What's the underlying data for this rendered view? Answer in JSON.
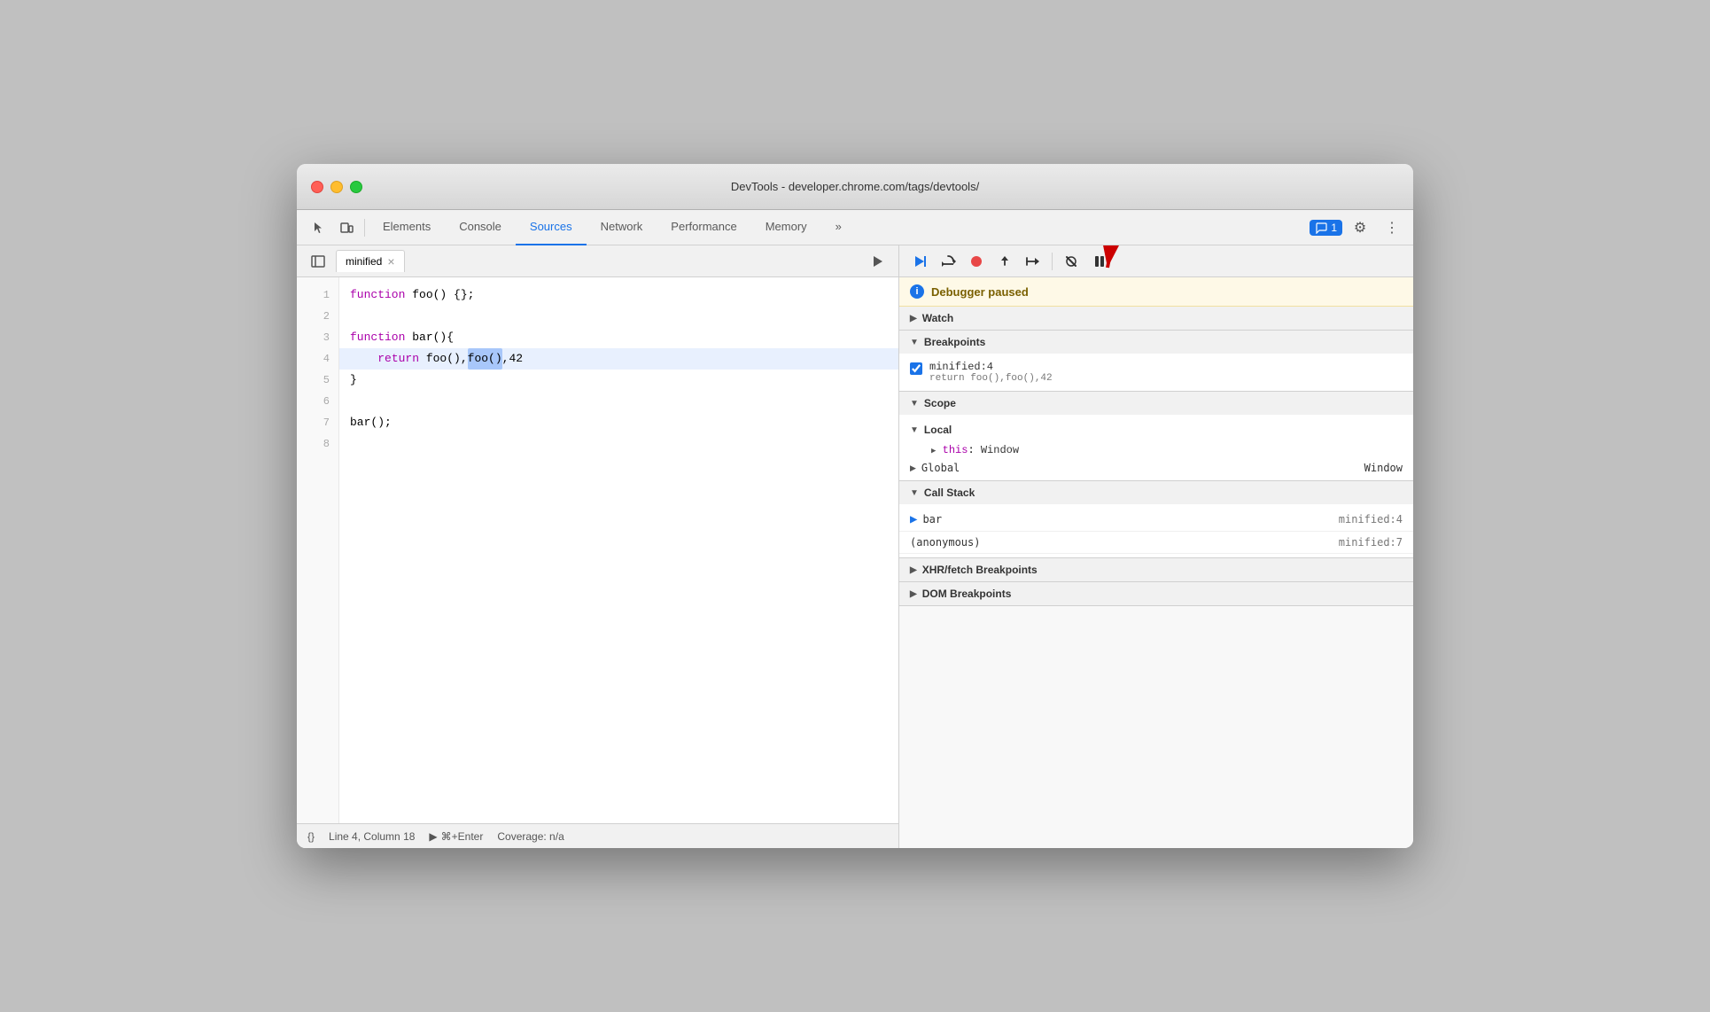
{
  "window": {
    "title": "DevTools - developer.chrome.com/tags/devtools/"
  },
  "tabs": [
    {
      "id": "elements",
      "label": "Elements",
      "active": false
    },
    {
      "id": "console",
      "label": "Console",
      "active": false
    },
    {
      "id": "sources",
      "label": "Sources",
      "active": true
    },
    {
      "id": "network",
      "label": "Network",
      "active": false
    },
    {
      "id": "performance",
      "label": "Performance",
      "active": false
    },
    {
      "id": "memory",
      "label": "Memory",
      "active": false
    }
  ],
  "toolbar": {
    "more_label": "»",
    "notification_count": "1",
    "settings_icon": "⚙",
    "more_options_icon": "⋮"
  },
  "source_file": {
    "name": "minified",
    "lines": [
      {
        "num": "1",
        "content": "function foo() {};",
        "highlighted": false
      },
      {
        "num": "2",
        "content": "",
        "highlighted": false
      },
      {
        "num": "3",
        "content": "function bar(){",
        "highlighted": false
      },
      {
        "num": "4",
        "content": "    return foo(),foo(),42",
        "highlighted": true
      },
      {
        "num": "5",
        "content": "}",
        "highlighted": false
      },
      {
        "num": "6",
        "content": "",
        "highlighted": false
      },
      {
        "num": "7",
        "content": "bar();",
        "highlighted": false
      },
      {
        "num": "8",
        "content": "",
        "highlighted": false
      }
    ]
  },
  "status_bar": {
    "format_icon": "{}",
    "position": "Line 4, Column 18",
    "run_icon": "▶",
    "shortcut": "⌘+Enter",
    "coverage": "Coverage: n/a"
  },
  "debugger": {
    "paused_message": "Debugger paused",
    "watch_label": "Watch",
    "breakpoints_label": "Breakpoints",
    "scope_label": "Scope",
    "local_label": "Local",
    "this_label": "this",
    "this_value": "Window",
    "global_label": "Global",
    "global_value": "Window",
    "call_stack_label": "Call Stack",
    "xhr_breakpoints_label": "XHR/fetch Breakpoints",
    "dom_breakpoints_label": "DOM Breakpoints",
    "breakpoint": {
      "location": "minified:4",
      "code": "return foo(),foo(),42"
    },
    "call_stack": [
      {
        "name": "bar",
        "location": "minified:4",
        "active": true
      },
      {
        "name": "(anonymous)",
        "location": "minified:7",
        "active": false
      }
    ]
  },
  "debug_controls": {
    "resume": "▶",
    "step_over": "↷",
    "step_into": "↓",
    "step_out": "↑",
    "step": "→",
    "deactivate": "⊘",
    "pause_on_exception": "⏸"
  }
}
